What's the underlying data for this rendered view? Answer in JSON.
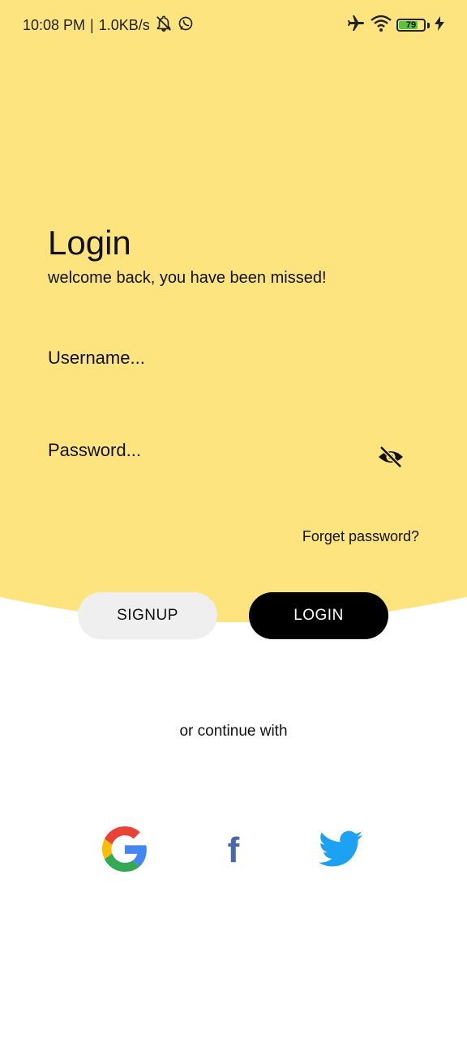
{
  "colors": {
    "accent_bg": "#fde47f",
    "primary_button": "#000000",
    "secondary_button": "#efefef",
    "battery_fill": "#5ac43a"
  },
  "status_bar": {
    "time": "10:08 PM",
    "separator": "|",
    "network_speed": "1.0KB/s",
    "battery_level": "79",
    "battery_fraction": 0.79,
    "icons": [
      "notifications-off-icon",
      "whatsapp-icon",
      "airplane-icon",
      "wifi-icon",
      "battery-icon",
      "charging-bolt-icon"
    ]
  },
  "login": {
    "title": "Login",
    "subtitle": "welcome back, you have been missed!",
    "username_placeholder": "Username...",
    "password_placeholder": "Password...",
    "visibility_icon": "visibility-off-icon",
    "forgot_label": "Forget password?",
    "signup_label": "SIGNUP",
    "login_label": "LOGIN"
  },
  "social": {
    "divider_text": "or continue with",
    "providers": [
      "google-icon",
      "facebook-icon",
      "twitter-icon"
    ]
  }
}
